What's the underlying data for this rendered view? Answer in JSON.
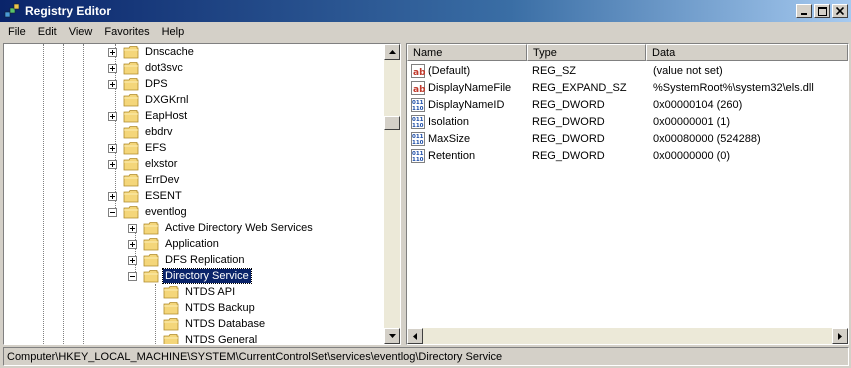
{
  "window": {
    "title": "Registry Editor"
  },
  "menu": [
    "File",
    "Edit",
    "View",
    "Favorites",
    "Help"
  ],
  "tree": [
    {
      "label": "Dnscache",
      "expander": "plus"
    },
    {
      "label": "dot3svc",
      "expander": "plus"
    },
    {
      "label": "DPS",
      "expander": "plus"
    },
    {
      "label": "DXGKrnl",
      "expander": "none"
    },
    {
      "label": "EapHost",
      "expander": "plus"
    },
    {
      "label": "ebdrv",
      "expander": "none"
    },
    {
      "label": "EFS",
      "expander": "plus"
    },
    {
      "label": "elxstor",
      "expander": "plus"
    },
    {
      "label": "ErrDev",
      "expander": "none"
    },
    {
      "label": "ESENT",
      "expander": "plus"
    },
    {
      "label": "eventlog",
      "expander": "minus"
    },
    {
      "label": "Active Directory Web Services",
      "expander": "plus"
    },
    {
      "label": "Application",
      "expander": "plus"
    },
    {
      "label": "DFS Replication",
      "expander": "plus"
    },
    {
      "label": "Directory Service",
      "expander": "minus",
      "selected": true
    },
    {
      "label": "NTDS API",
      "expander": "none"
    },
    {
      "label": "NTDS Backup",
      "expander": "none"
    },
    {
      "label": "NTDS Database",
      "expander": "none"
    },
    {
      "label": "NTDS General",
      "expander": "none"
    }
  ],
  "columns": {
    "name": "Name",
    "type": "Type",
    "data": "Data"
  },
  "values": [
    {
      "name": "(Default)",
      "type": "REG_SZ",
      "data": "(value not set)",
      "icon": "string-value-icon"
    },
    {
      "name": "DisplayNameFile",
      "type": "REG_EXPAND_SZ",
      "data": "%SystemRoot%\\system32\\els.dll",
      "icon": "string-value-icon"
    },
    {
      "name": "DisplayNameID",
      "type": "REG_DWORD",
      "data": "0x00000104 (260)",
      "icon": "binary-value-icon"
    },
    {
      "name": "Isolation",
      "type": "REG_DWORD",
      "data": "0x00000001 (1)",
      "icon": "binary-value-icon"
    },
    {
      "name": "MaxSize",
      "type": "REG_DWORD",
      "data": "0x00080000 (524288)",
      "icon": "binary-value-icon"
    },
    {
      "name": "Retention",
      "type": "REG_DWORD",
      "data": "0x00000000 (0)",
      "icon": "binary-value-icon"
    }
  ],
  "status": {
    "path": "Computer\\HKEY_LOCAL_MACHINE\\SYSTEM\\CurrentControlSet\\services\\eventlog\\Directory Service"
  },
  "colors": {
    "titlebar": "#0a246a",
    "selection": "#0a246a",
    "face": "#d4d0c8",
    "folder": "#f4d67a"
  }
}
